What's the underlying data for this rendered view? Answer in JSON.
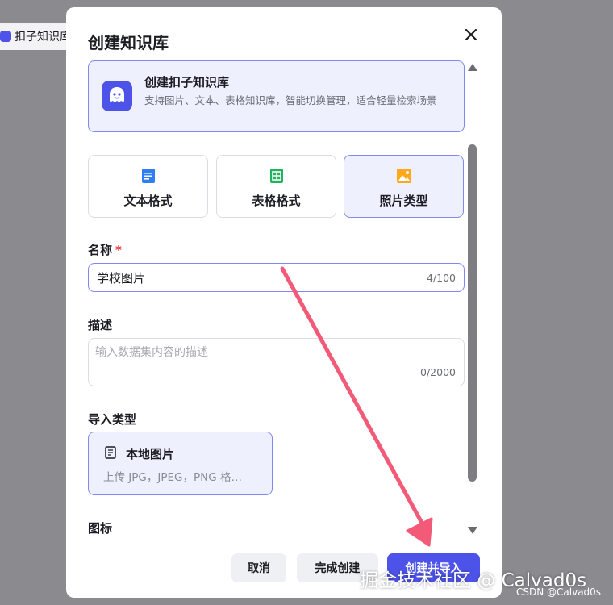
{
  "background": {
    "chip_label": "扣子知识库"
  },
  "modal": {
    "title": "创建知识库",
    "kb_type": {
      "title": "创建扣子知识库",
      "desc": "支持图片、文本、表格知识库，智能切换管理，适合轻量检索场景"
    },
    "formats": [
      {
        "label": "文本格式",
        "icon": "text-doc-icon",
        "color": "#2f7ff0",
        "active": false
      },
      {
        "label": "表格格式",
        "icon": "table-icon",
        "color": "#22b35e",
        "active": false
      },
      {
        "label": "照片类型",
        "icon": "image-icon",
        "color": "#ffa81a",
        "active": true
      }
    ],
    "name": {
      "label": "名称",
      "required_mark": "*",
      "value": "学校图片",
      "counter": "4/100"
    },
    "description": {
      "label": "描述",
      "placeholder": "输入数据集内容的描述",
      "counter": "0/2000"
    },
    "import": {
      "label": "导入类型",
      "title": "本地图片",
      "desc": "上传 JPG，JPEG，PNG 格…"
    },
    "icon_label": "图标",
    "buttons": {
      "cancel": "取消",
      "finish": "完成创建",
      "create_import": "创建并导入"
    }
  },
  "watermark": {
    "main": "掘金技术社区 @ Calvad0s",
    "small": "CSDN @Calvad0s"
  },
  "colors": {
    "accent": "#4d53e8",
    "accent_light": "#eef0fe",
    "annotation_arrow": "#f25a78"
  }
}
